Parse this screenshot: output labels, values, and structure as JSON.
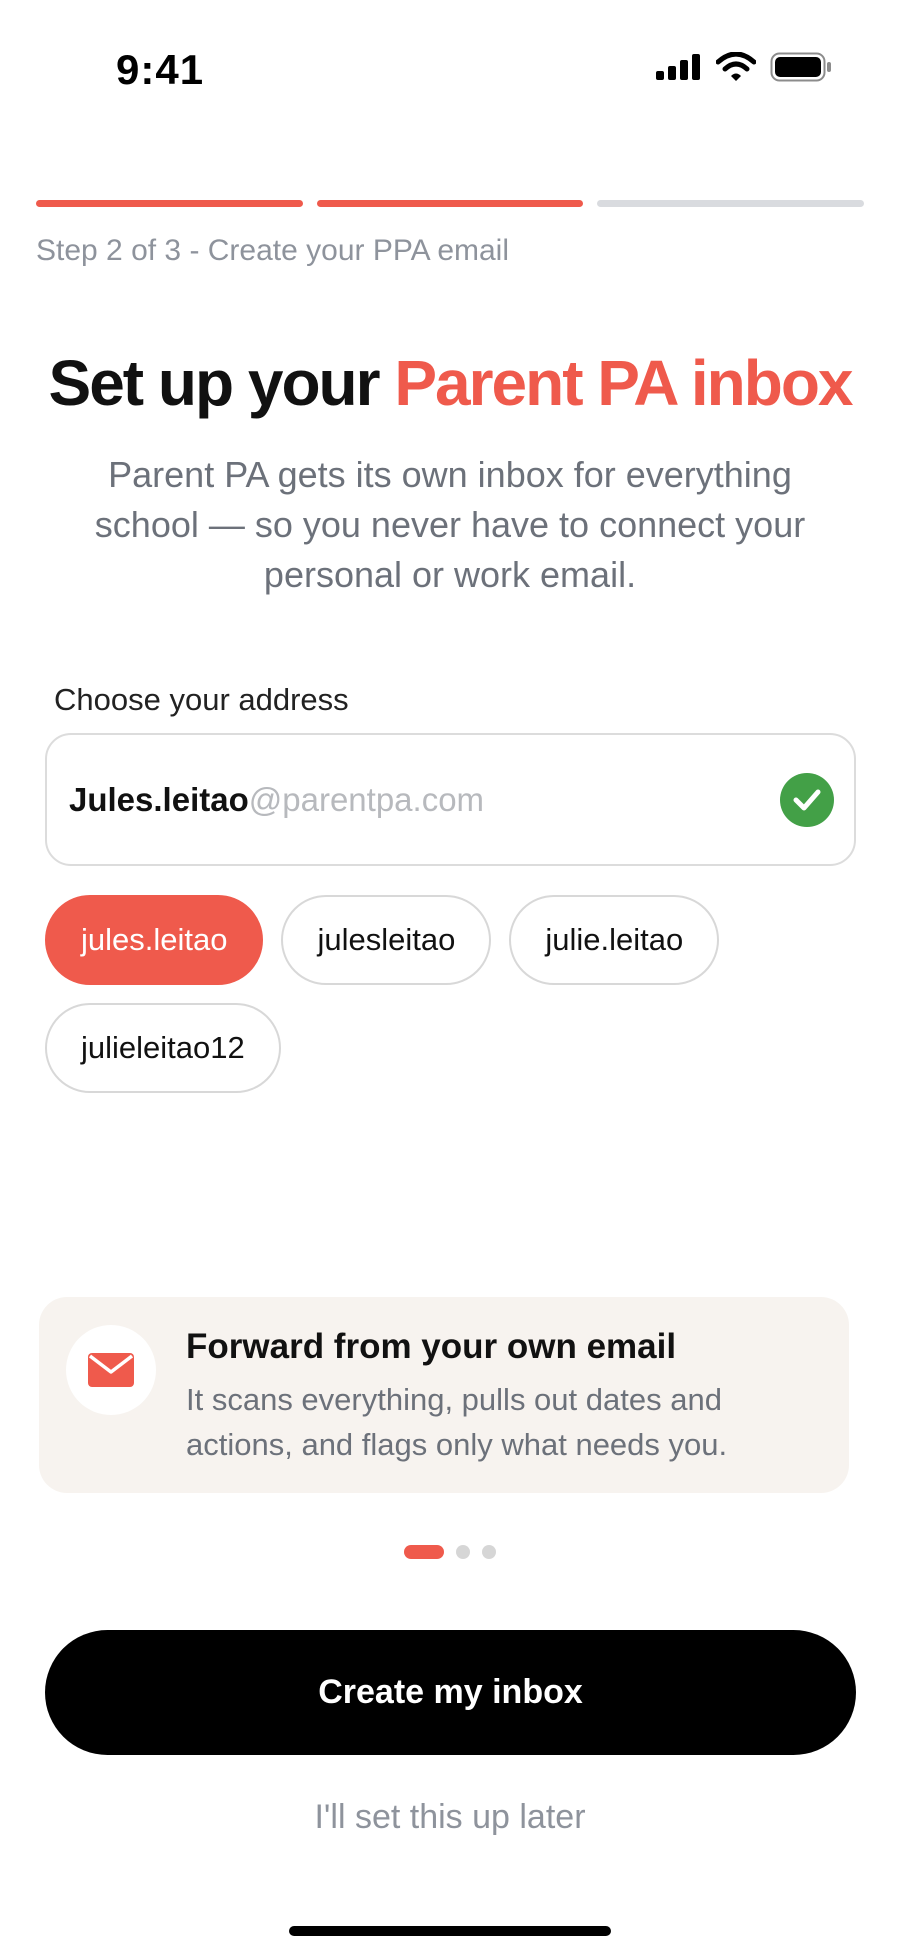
{
  "status_bar": {
    "time": "9:41",
    "icons": [
      "cellular-signal-icon",
      "wifi-icon",
      "battery-icon"
    ]
  },
  "progress": {
    "current_step": 2,
    "total_steps": 3,
    "label": "Step 2 of 3 - Create your PPA email"
  },
  "header": {
    "title_part1": "Set up your ",
    "title_accent": "Parent PA inbox",
    "subtitle": "Parent PA gets its own inbox for everything school — so you never have to connect your personal or work email."
  },
  "address": {
    "label": "Choose your address",
    "username": "Jules.leitao",
    "domain": "@parentpa.com",
    "status_icon": "check-circle-icon"
  },
  "suggestions": [
    {
      "label": "jules.leitao",
      "selected": true
    },
    {
      "label": "julesleitao",
      "selected": false
    },
    {
      "label": "julie.leitao",
      "selected": false
    },
    {
      "label": "julieleitao12",
      "selected": false
    }
  ],
  "info_card": {
    "icon": "mail-icon",
    "title": "Forward from your own email",
    "body": "It scans everything, pulls out dates and actions, and flags only what needs you."
  },
  "pager": {
    "count": 3,
    "active_index": 0
  },
  "actions": {
    "primary_label": "Create my inbox",
    "secondary_label": "I'll set this up later"
  },
  "colors": {
    "accent": "#ef5a4c",
    "success": "#43a047",
    "primary_button": "#000000",
    "card_background": "#f7f3ef"
  }
}
